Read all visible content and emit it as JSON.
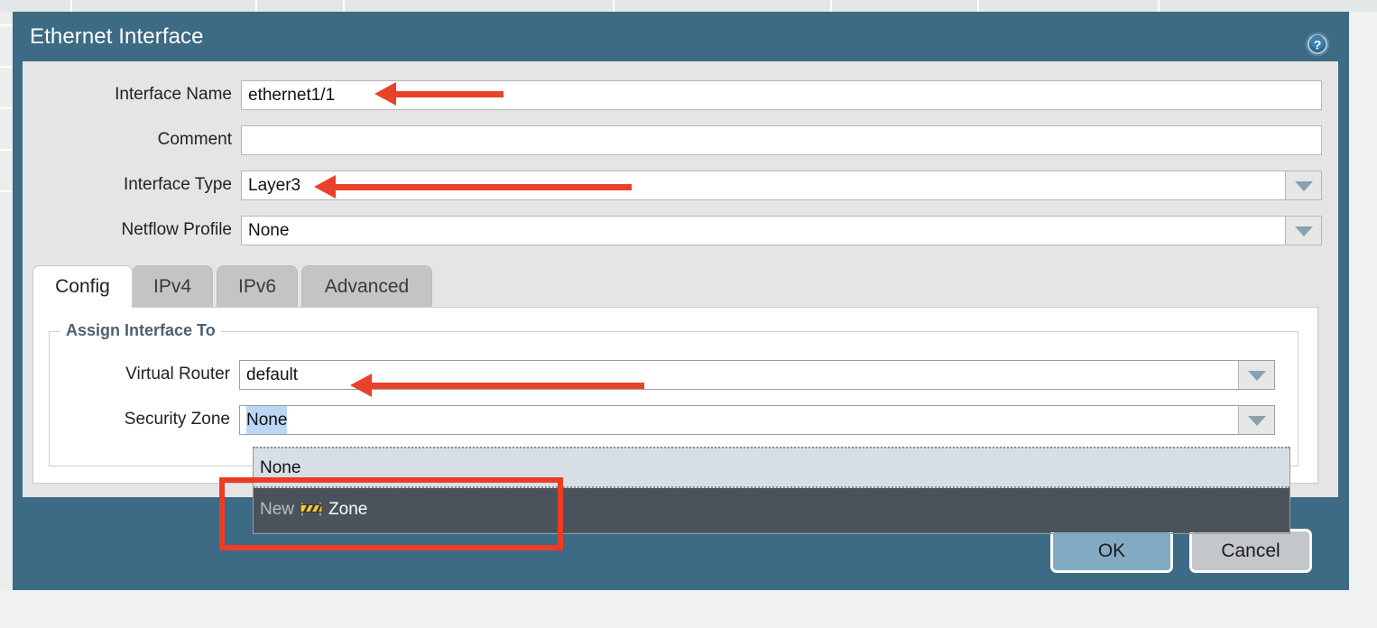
{
  "window": {
    "title": "Ethernet Interface",
    "help_icon": "help-question-icon",
    "accent_color": "#3d6a84",
    "annotation_color": "#e8432a"
  },
  "form": {
    "fields": [
      {
        "label": "Interface Name",
        "value": "ethernet1/1",
        "type": "text"
      },
      {
        "label": "Comment",
        "value": "",
        "type": "text"
      },
      {
        "label": "Interface Type",
        "value": "Layer3",
        "type": "select"
      },
      {
        "label": "Netflow Profile",
        "value": "None",
        "type": "select"
      }
    ]
  },
  "tabs": [
    {
      "label": "Config",
      "active": true
    },
    {
      "label": "IPv4",
      "active": false
    },
    {
      "label": "IPv6",
      "active": false
    },
    {
      "label": "Advanced",
      "active": false
    }
  ],
  "config_panel": {
    "fieldset_legend": "Assign Interface To",
    "fields": [
      {
        "label": "Virtual Router",
        "value": "default",
        "type": "select"
      },
      {
        "label": "Security Zone",
        "value": "None",
        "type": "select",
        "open": true
      }
    ]
  },
  "zone_dropdown": {
    "options": [
      {
        "label": "None",
        "state": "selected"
      },
      {
        "label_prefix": "New",
        "icon": "zone-barrier-icon",
        "label_suffix": "Zone",
        "state": "hovered"
      }
    ]
  },
  "footer": {
    "ok_label": "OK",
    "cancel_label": "Cancel"
  },
  "annotations": {
    "arrow_interface_name": "arrow-pointing-to-interface-name",
    "arrow_interface_type": "arrow-pointing-to-interface-type",
    "arrow_virtual_router": "arrow-pointing-to-virtual-router",
    "box_new_zone": "highlight-box-around-new-zone-option"
  }
}
